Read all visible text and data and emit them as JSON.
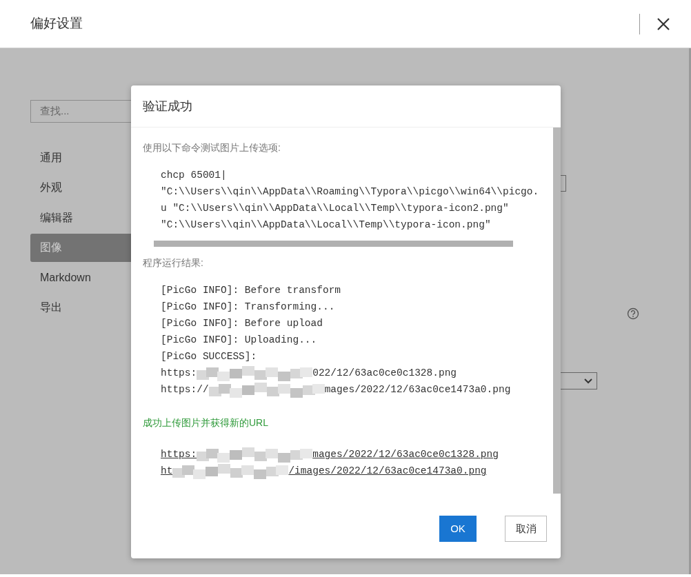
{
  "window": {
    "title": "偏好设置"
  },
  "sidebar": {
    "search": {
      "placeholder": "查找..."
    },
    "items": [
      {
        "label": "通用",
        "selected": false
      },
      {
        "label": "外观",
        "selected": false
      },
      {
        "label": "编辑器",
        "selected": false
      },
      {
        "label": "图像",
        "selected": true
      },
      {
        "label": "Markdown",
        "selected": false
      },
      {
        "label": "导出",
        "selected": false
      }
    ]
  },
  "dialog": {
    "title": "验证成功",
    "command_label": "使用以下命令测试图片上传选项:",
    "command_lines": [
      "chcp 65001|",
      "\"C:\\\\Users\\\\qin\\\\AppData\\\\Roaming\\\\Typora\\\\picgo\\\\win64\\\\picgo.",
      "u \"C:\\\\Users\\\\qin\\\\AppData\\\\Local\\\\Temp\\\\typora-icon2.png\"",
      "\"C:\\\\Users\\\\qin\\\\AppData\\\\Local\\\\Temp\\\\typora-icon.png\""
    ],
    "result_label": "程序运行结果:",
    "result_lines": [
      {
        "kind": "text",
        "text": "[PicGo INFO]: Before transform"
      },
      {
        "kind": "text",
        "text": "[PicGo INFO]: Transforming..."
      },
      {
        "kind": "text",
        "text": "[PicGo INFO]: Before upload"
      },
      {
        "kind": "text",
        "text": "[PicGo INFO]: Uploading..."
      },
      {
        "kind": "text",
        "text": "[PicGo SUCCESS]:"
      },
      {
        "kind": "redacted",
        "prefix": "https:",
        "suffix": "022/12/63ac0ce0c1328.png"
      },
      {
        "kind": "redacted",
        "prefix": "https://",
        "suffix": "mages/2022/12/63ac0ce1473a0.png"
      }
    ],
    "success_message": "成功上传图片并获得新的URL",
    "uploaded_urls": [
      {
        "prefix": "https:",
        "suffix": "mages/2022/12/63ac0ce0c1328.png"
      },
      {
        "prefix": "ht",
        "suffix": "/images/2022/12/63ac0ce1473a0.png"
      }
    ],
    "buttons": [
      {
        "label": "OK",
        "kind": "primary"
      },
      {
        "label": "取消",
        "kind": "secondary"
      }
    ]
  }
}
